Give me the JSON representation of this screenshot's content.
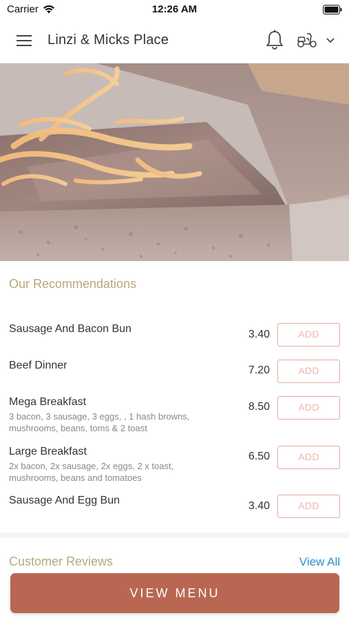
{
  "status_bar": {
    "carrier": "Carrier",
    "time": "12:26 AM"
  },
  "header": {
    "title": "Linzi & Micks Place",
    "icons": [
      "hamburger-menu-icon",
      "bell-icon",
      "scooter-icon",
      "chevron-down-icon"
    ]
  },
  "hero": {
    "image": "chocolate cake with candied orange peel"
  },
  "recommendations": {
    "title": "Our Recommendations",
    "add_label": "ADD",
    "items": [
      {
        "name": "Sausage And Bacon Bun",
        "description": "",
        "price": "3.40"
      },
      {
        "name": "Beef Dinner",
        "description": "",
        "price": "7.20"
      },
      {
        "name": "Mega Breakfast",
        "description": "3 bacon, 3 sausage, 3 eggs, , 1  hash browns, mushrooms, beans, toms & 2 toast",
        "price": "8.50"
      },
      {
        "name": "Large Breakfast",
        "description": "2x bacon, 2x sausage, 2x eggs, 2 x toast, mushrooms, beans and tomatoes",
        "price": "6.50"
      },
      {
        "name": "Sausage And Egg Bun",
        "description": "",
        "price": "3.40"
      }
    ]
  },
  "reviews": {
    "title": "Customer Reviews",
    "view_all": "View All"
  },
  "footer": {
    "view_menu": "VIEW MENU"
  },
  "colors": {
    "accent": "#b96752",
    "section_title": "#b8a77e",
    "link": "#2c8fc9",
    "add_border": "#e1ab9e"
  }
}
